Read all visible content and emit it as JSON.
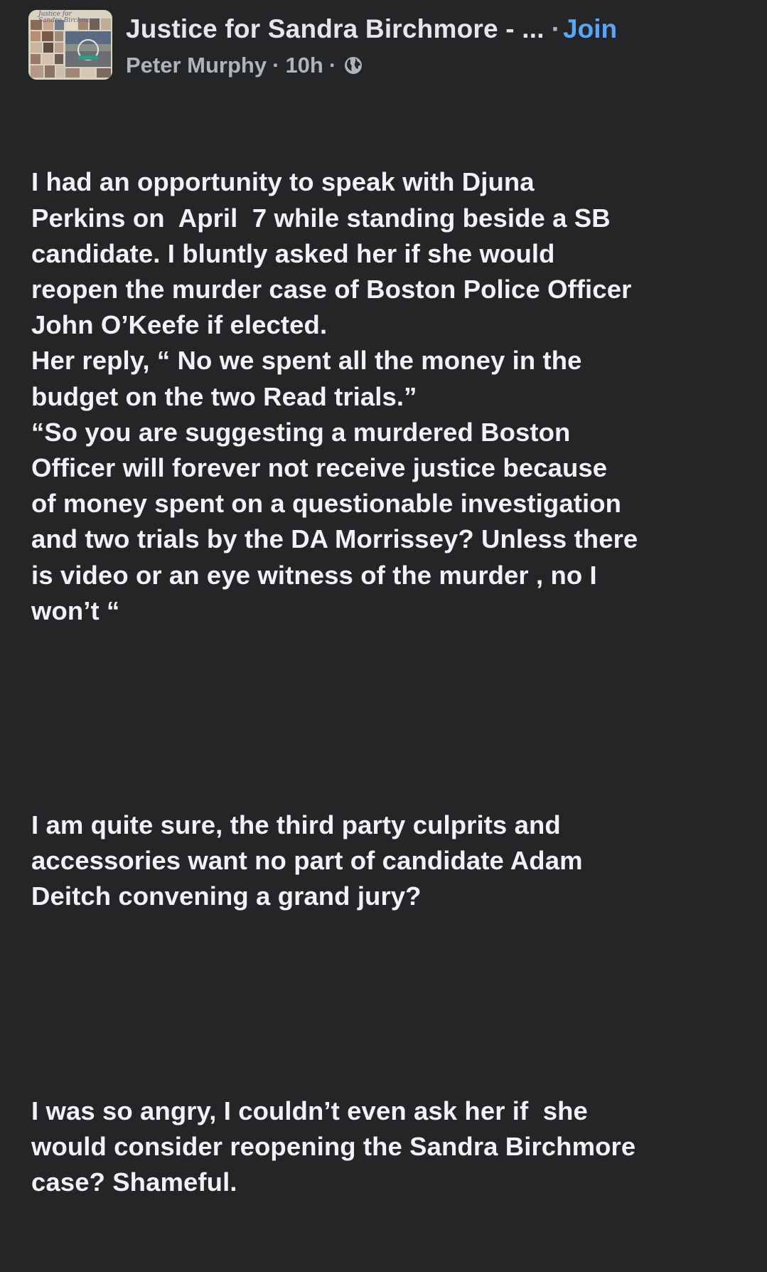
{
  "post": {
    "group_name": "Justice for Sandra Birchmore - ...",
    "separator": "·",
    "join_label": "Join",
    "author": "Peter Murphy",
    "timestamp": "10h",
    "audience_icon": "globe-icon",
    "avatar_caption_line1": "Justice for",
    "avatar_caption_line2": "Sandra Birchmore",
    "paragraphs": [
      "I had an opportunity to speak with Djuna\nPerkins on  April  7 while standing beside a SB\ncandidate. I bluntly asked her if she would\nreopen the murder case of Boston Police Officer\nJohn O’Keefe if elected.\nHer reply, “ No we spent all the money in the\nbudget on the two Read trials.”\n“So you are suggesting a murdered Boston\nOfficer will forever not receive justice because\nof money spent on a questionable investigation\nand two trials by the DA Morrissey? Unless there\nis video or an eye witness of the murder , no I\nwon’t “",
      "I am quite sure, the third party culprits and\naccessories want no part of candidate Adam\nDeitch convening a grand jury?",
      "I was so angry, I couldn’t even ask her if  she\nwould consider reopening the Sandra Birchmore\ncase? Shameful."
    ]
  },
  "colors": {
    "background": "#242526",
    "primary_text": "#e4e6eb",
    "secondary_text": "#b0b3b8",
    "link_blue": "#5ba4f8"
  }
}
